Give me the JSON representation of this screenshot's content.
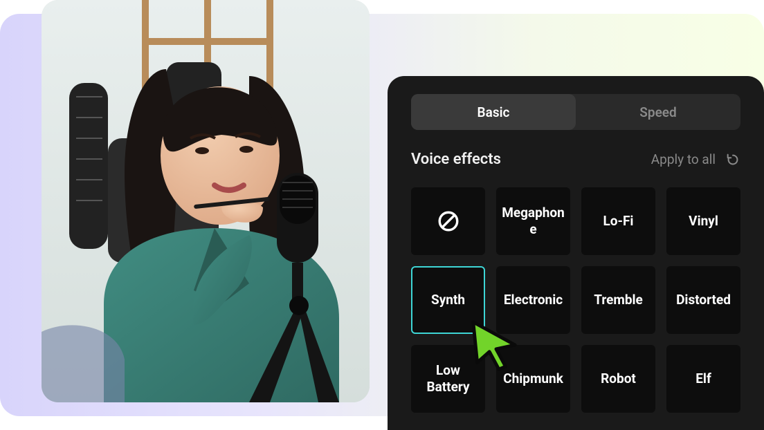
{
  "tabs": {
    "basic": "Basic",
    "speed": "Speed"
  },
  "panel": {
    "title": "Voice effects",
    "apply_label": "Apply to all"
  },
  "effects": {
    "none": "",
    "megaphone": "Megaphone",
    "lofi": "Lo-Fi",
    "vinyl": "Vinyl",
    "synth": "Synth",
    "electronic": "Electronic",
    "tremble": "Tremble",
    "distorted": "Distorted",
    "lowbattery": "Low Battery",
    "chipmunk": "Chipmunk",
    "robot": "Robot",
    "elf": "Elf"
  }
}
